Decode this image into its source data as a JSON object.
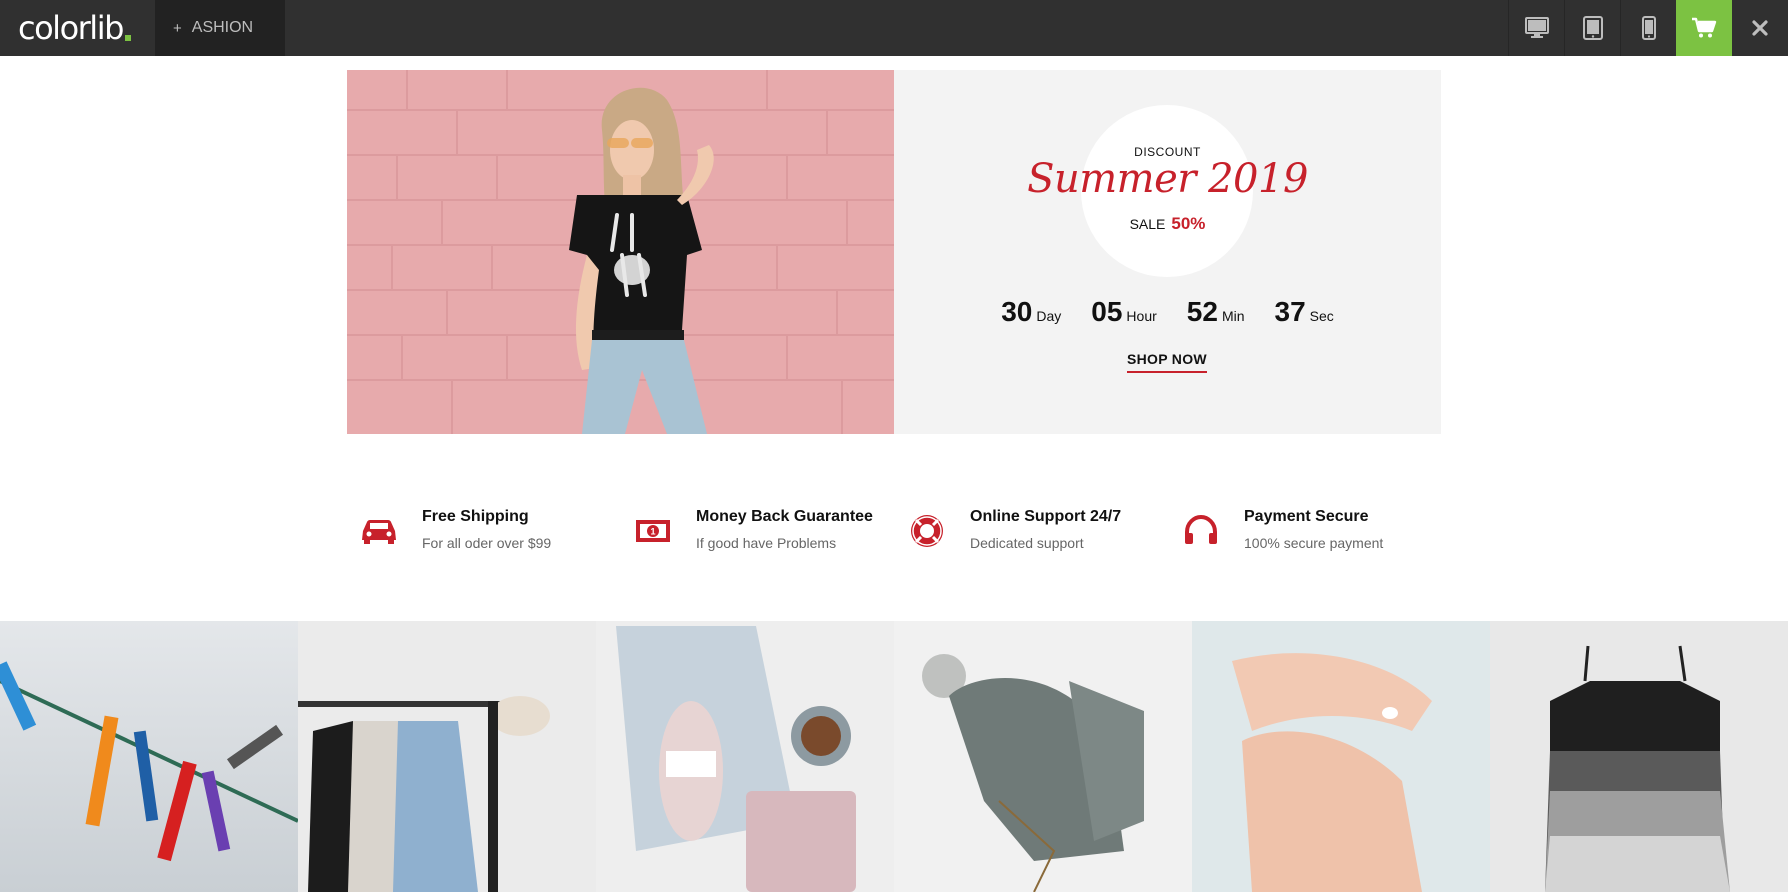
{
  "topbar": {
    "logo": "colorlib",
    "theme_tab": {
      "plus": "+",
      "label": "ASHION"
    },
    "icons": [
      "desktop-icon",
      "tablet-icon",
      "mobile-icon",
      "cart-icon",
      "close-icon"
    ],
    "colors": {
      "bar": "#303030",
      "cart_bg": "#7cc242"
    }
  },
  "hero": {
    "discount": "DISCOUNT",
    "title": "Summer 2019",
    "sale_label": "SALE",
    "sale_value": "50%",
    "countdown": [
      {
        "value": "30",
        "unit": "Day"
      },
      {
        "value": "05",
        "unit": "Hour"
      },
      {
        "value": "52",
        "unit": "Min"
      },
      {
        "value": "37",
        "unit": "Sec"
      }
    ],
    "shop_now": "SHOP NOW",
    "accent": "#c7212b"
  },
  "features": [
    {
      "icon": "car-icon",
      "title": "Free Shipping",
      "subtitle": "For all oder over $99"
    },
    {
      "icon": "money-icon",
      "title": "Money Back Guarantee",
      "subtitle": "If good have Problems"
    },
    {
      "icon": "lifebuoy-icon",
      "title": "Online Support 24/7",
      "subtitle": "Dedicated support"
    },
    {
      "icon": "headphones-icon",
      "title": "Payment Secure",
      "subtitle": "100% secure payment"
    }
  ],
  "gallery": [
    "clothespins-photo",
    "clothing-rack-photo",
    "knitting-flatlay-photo",
    "knit-hat-photo",
    "hand-cream-photo",
    "tank-tops-photo"
  ]
}
